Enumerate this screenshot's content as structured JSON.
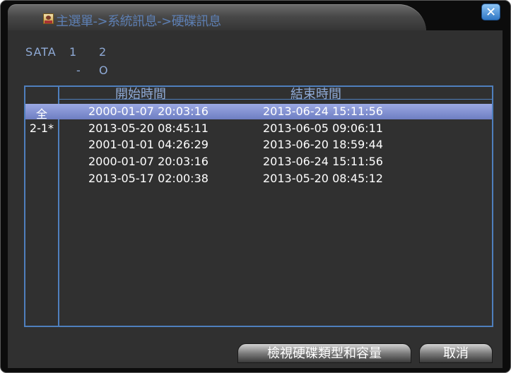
{
  "window": {
    "breadcrumb": "主選單->系統訊息->硬碟訊息",
    "close_glyph": "✕"
  },
  "sata": {
    "label": "SATA",
    "ports": [
      "1",
      "2"
    ],
    "statuses": [
      "-",
      "O"
    ]
  },
  "list": {
    "headers": {
      "start": "開始時間",
      "end": "結束時間"
    },
    "side_items": [
      "全",
      "2-1*"
    ],
    "rows": [
      {
        "start": "2000-01-07 20:03:16",
        "end": "2013-06-24 15:11:56",
        "selected": true
      },
      {
        "start": "2013-05-20 08:45:11",
        "end": "2013-06-05 09:06:11",
        "selected": false
      },
      {
        "start": "2001-01-01 04:26:29",
        "end": "2013-06-20 18:59:44",
        "selected": false
      },
      {
        "start": "2000-01-07 20:03:16",
        "end": "2013-06-24 15:11:56",
        "selected": false
      },
      {
        "start": "2013-05-17 02:00:38",
        "end": "2013-05-20 08:45:12",
        "selected": false
      }
    ]
  },
  "buttons": {
    "view_type_capacity": "檢視硬碟類型和容量",
    "cancel": "取消"
  },
  "colors": {
    "accent_text": "#8faad6",
    "border_blue": "#4f7fbd",
    "selection": "#8796d6"
  }
}
